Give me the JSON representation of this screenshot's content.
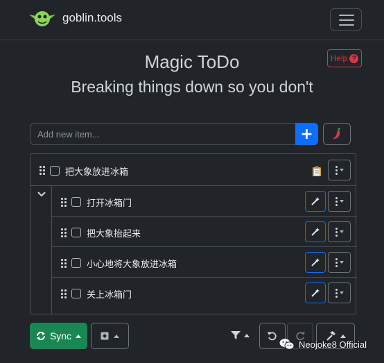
{
  "header": {
    "brand": "goblin.tools",
    "menu_icon": "hamburger-icon"
  },
  "main": {
    "title": "Magic ToDo",
    "subtitle": "Breaking things down so you don't",
    "help_label": "Help"
  },
  "input": {
    "placeholder": "Add new item...",
    "add_icon": "plus-icon",
    "spiciness_icon": "chili-pepper-icon"
  },
  "tasks": {
    "root": {
      "label": "把大象放进冰箱",
      "note_icon": "clipboard-icon",
      "expanded": true
    },
    "subtasks": [
      {
        "label": "打开冰箱门"
      },
      {
        "label": "把大象抬起来"
      },
      {
        "label": "小心地将大象放进冰箱"
      },
      {
        "label": "关上冰箱门"
      }
    ]
  },
  "toolbar": {
    "sync_label": "Sync",
    "export_icon": "export-icon",
    "filter_icon": "filter-icon",
    "undo_icon": "undo-icon",
    "redo_icon": "redo-icon",
    "tools_icon": "hammer-icon"
  },
  "watermark": {
    "text": "Neojoke8 Official"
  },
  "colors": {
    "background": "#212529",
    "primary": "#0d6efd",
    "success": "#198754",
    "danger": "#dc3545",
    "goblin_green": "#6fbf3f"
  }
}
